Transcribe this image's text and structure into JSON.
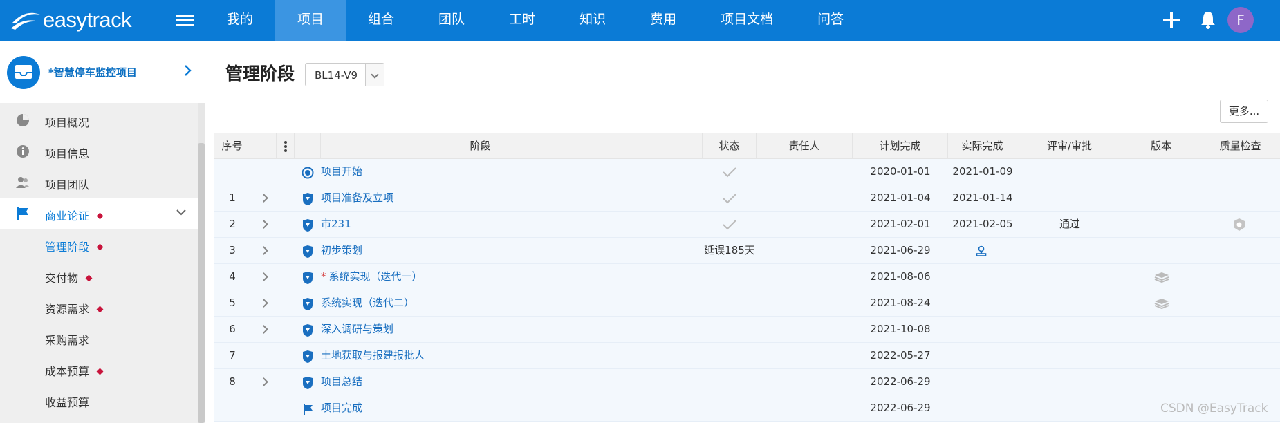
{
  "app": {
    "logo_text": "easytrack"
  },
  "nav": {
    "items": [
      "我的",
      "项目",
      "组合",
      "团队",
      "工时",
      "知识",
      "费用",
      "项目文档",
      "问答"
    ],
    "active_index": 1
  },
  "user": {
    "avatar_letter": "F",
    "avatar_color": "#8e67c8"
  },
  "project": {
    "name": "*智慧停车监控项目"
  },
  "sidebar": {
    "items": [
      {
        "label": "项目概况",
        "icon": "pie-chart-icon"
      },
      {
        "label": "项目信息",
        "icon": "info-icon"
      },
      {
        "label": "项目团队",
        "icon": "team-icon"
      },
      {
        "label": "商业论证",
        "icon": "flag-icon"
      }
    ],
    "subitems": [
      {
        "label": "管理阶段",
        "marked": true
      },
      {
        "label": "交付物",
        "marked": true
      },
      {
        "label": "资源需求",
        "marked": true
      },
      {
        "label": "采购需求",
        "marked": false
      },
      {
        "label": "成本预算",
        "marked": true
      },
      {
        "label": "收益预算",
        "marked": false
      }
    ]
  },
  "page": {
    "title": "管理阶段",
    "version_value": "BL14-V9",
    "more_label": "更多..."
  },
  "table": {
    "headers": {
      "index": "序号",
      "stage": "阶段",
      "status": "状态",
      "owner": "责任人",
      "planned": "计划完成",
      "actual": "实际完成",
      "review": "评审/审批",
      "version": "版本",
      "quality": "质量检查"
    },
    "rows": [
      {
        "index": "",
        "expandable": false,
        "icon": "milestone-start-icon",
        "required": false,
        "stage": "项目开始",
        "status": "check",
        "delay_text": "",
        "planned": "2020-01-01",
        "actual": "2021-01-09",
        "review": "",
        "review_icon": "",
        "version_icon": "",
        "quality_icon": ""
      },
      {
        "index": "1",
        "expandable": true,
        "icon": "shield-stage-icon",
        "required": false,
        "stage": "项目准备及立项",
        "status": "check",
        "delay_text": "",
        "planned": "2021-01-04",
        "actual": "2021-01-14",
        "review": "",
        "review_icon": "",
        "version_icon": "",
        "quality_icon": ""
      },
      {
        "index": "2",
        "expandable": true,
        "icon": "shield-stage-icon",
        "required": false,
        "stage": "市231",
        "status": "check",
        "delay_text": "",
        "planned": "2021-02-01",
        "actual": "2021-02-05",
        "review": "通过",
        "review_icon": "",
        "version_icon": "",
        "quality_icon": "quality-shield-icon"
      },
      {
        "index": "3",
        "expandable": true,
        "icon": "shield-stage-icon",
        "required": false,
        "stage": "初步策划",
        "status": "delay",
        "delay_text": "延误185天",
        "planned": "2021-06-29",
        "actual": "",
        "review": "",
        "review_icon": "stamp-icon",
        "version_icon": "",
        "quality_icon": ""
      },
      {
        "index": "4",
        "expandable": true,
        "icon": "shield-stage-icon",
        "required": true,
        "stage": "系统实现（迭代一）",
        "status": "",
        "delay_text": "",
        "planned": "2021-08-06",
        "actual": "",
        "review": "",
        "review_icon": "",
        "version_icon": "layers-icon",
        "quality_icon": ""
      },
      {
        "index": "5",
        "expandable": true,
        "icon": "shield-stage-icon",
        "required": false,
        "stage": "系统实现（迭代二）",
        "status": "",
        "delay_text": "",
        "planned": "2021-08-24",
        "actual": "",
        "review": "",
        "review_icon": "",
        "version_icon": "layers-icon",
        "quality_icon": ""
      },
      {
        "index": "6",
        "expandable": true,
        "icon": "shield-stage-icon",
        "required": false,
        "stage": "深入调研与策划",
        "status": "",
        "delay_text": "",
        "planned": "2021-10-08",
        "actual": "",
        "review": "",
        "review_icon": "",
        "version_icon": "",
        "quality_icon": ""
      },
      {
        "index": "7",
        "expandable": false,
        "icon": "shield-stage-icon",
        "required": false,
        "stage": "土地获取与报建报批人",
        "status": "",
        "delay_text": "",
        "planned": "2022-05-27",
        "actual": "",
        "review": "",
        "review_icon": "",
        "version_icon": "",
        "quality_icon": ""
      },
      {
        "index": "8",
        "expandable": true,
        "icon": "shield-stage-icon",
        "required": false,
        "stage": "项目总结",
        "status": "",
        "delay_text": "",
        "planned": "2022-06-29",
        "actual": "",
        "review": "",
        "review_icon": "",
        "version_icon": "",
        "quality_icon": ""
      },
      {
        "index": "",
        "expandable": false,
        "icon": "milestone-flag-icon",
        "required": false,
        "stage": "项目完成",
        "status": "",
        "delay_text": "",
        "planned": "2022-06-29",
        "actual": "",
        "review": "",
        "review_icon": "",
        "version_icon": "",
        "quality_icon": ""
      }
    ]
  },
  "watermark": "CSDN @EasyTrack",
  "colors": {
    "brand": "#0b7bd6",
    "delay": "#e0241b",
    "marker": "#c8143c"
  }
}
